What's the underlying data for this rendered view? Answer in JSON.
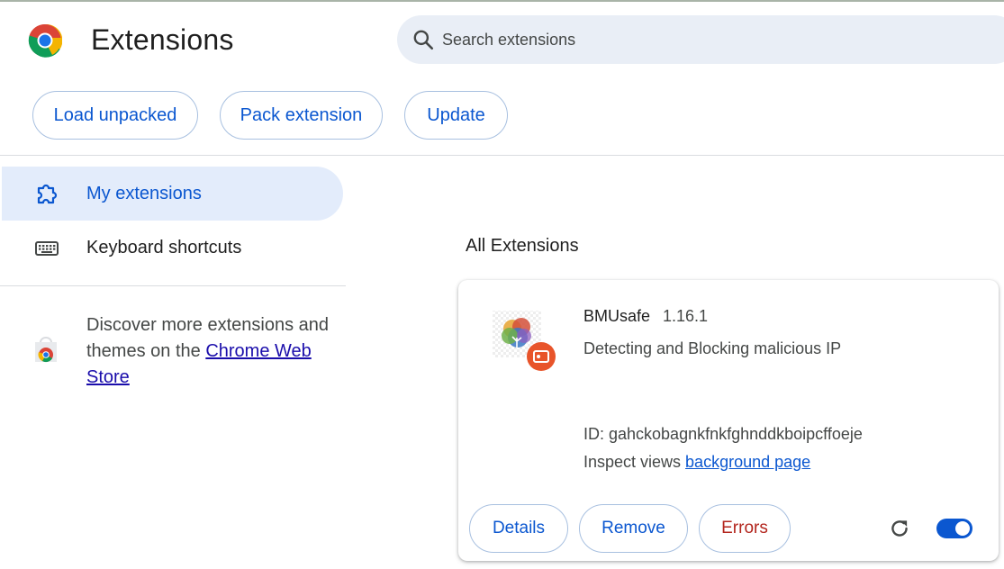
{
  "header": {
    "title": "Extensions",
    "search_placeholder": "Search extensions"
  },
  "toolbar": {
    "load_unpacked": "Load unpacked",
    "pack_extension": "Pack extension",
    "update": "Update"
  },
  "sidebar": {
    "items": [
      {
        "label": "My extensions",
        "icon": "extension-puzzle-icon",
        "active": true
      },
      {
        "label": "Keyboard shortcuts",
        "icon": "keyboard-icon",
        "active": false
      }
    ],
    "discover_text": "Discover more extensions and themes on the ",
    "store_link": "Chrome Web Store"
  },
  "main": {
    "section_title": "All Extensions",
    "extensions": [
      {
        "name": "BMUsafe",
        "version": "1.16.1",
        "description": "Detecting and Blocking malicious IP",
        "id_text": "ID: gahckobagnkfnkfghnddkboipcffoeje",
        "inspect_label": "Inspect views ",
        "inspect_link": "background page",
        "details_label": "Details",
        "remove_label": "Remove",
        "errors_label": "Errors",
        "enabled": true
      }
    ]
  },
  "colors": {
    "accent": "#0b57d0",
    "error": "#b3261e",
    "active_nav_bg": "#e3ecfb",
    "search_bg": "#e9eef6"
  }
}
